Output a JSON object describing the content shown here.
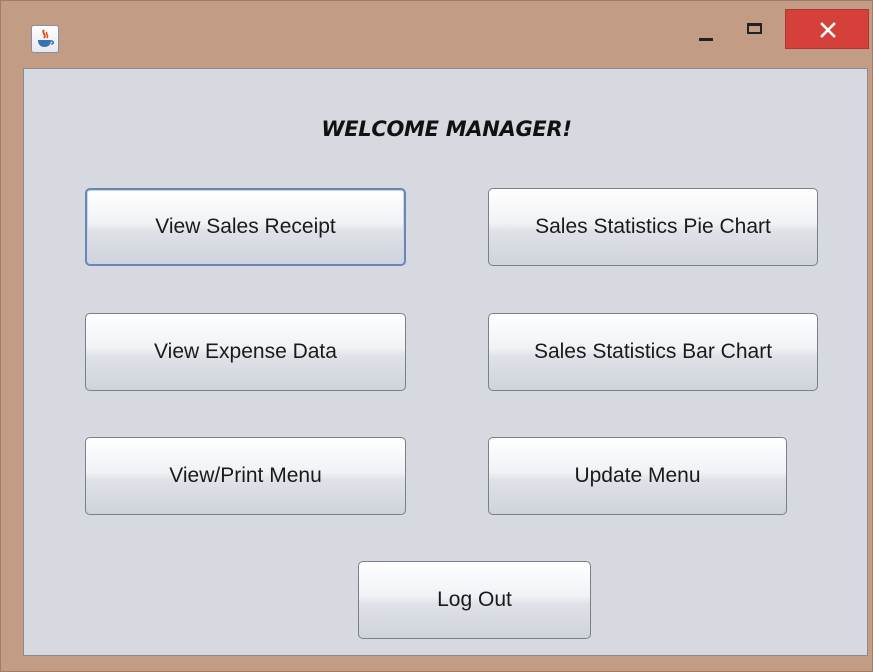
{
  "window": {
    "title": "",
    "icon": "java-cup-icon",
    "controls": {
      "minimize": "minimize-icon",
      "maximize": "maximize-icon",
      "close": "close-icon",
      "close_color": "#d5403a"
    }
  },
  "heading": "WELCOME MANAGER!",
  "buttons": {
    "view_sales_receipt": "View Sales Receipt",
    "sales_pie_chart": "Sales Statistics Pie Chart",
    "view_expense_data": "View Expense Data",
    "sales_bar_chart": "Sales Statistics Bar Chart",
    "view_print_menu": "View/Print Menu",
    "update_menu": "Update Menu",
    "log_out": "Log Out"
  },
  "colors": {
    "frame": "#c29c84",
    "client_background": "#d6d9e0",
    "focus_border": "#6b86b4"
  }
}
